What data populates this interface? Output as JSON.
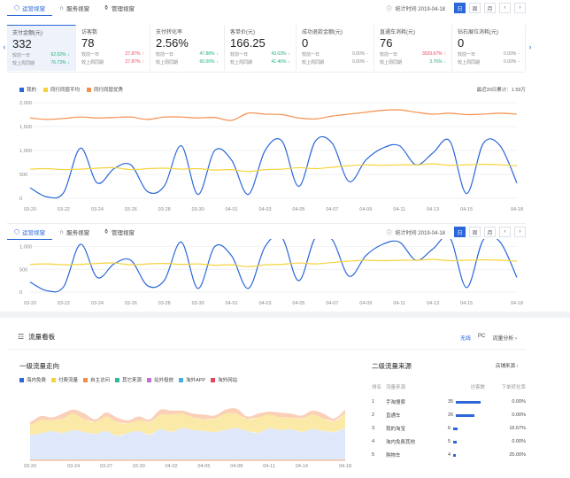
{
  "tabs": [
    {
      "label": "运营视窗",
      "icon": "shield-icon",
      "glyph": "⬡"
    },
    {
      "label": "服务视窗",
      "icon": "headset-icon",
      "glyph": "∩"
    },
    {
      "label": "管理视窗",
      "icon": "flask-icon",
      "glyph": "⚱"
    }
  ],
  "stat_time": {
    "icon": "info-icon",
    "glyph": "ⓘ",
    "label": "统计时间 2019-04-18"
  },
  "range_buttons": [
    "日",
    "周",
    "月"
  ],
  "prev_glyph": "‹",
  "next_glyph": "›",
  "kpis": [
    {
      "title": "支付金额(元)",
      "value": "332",
      "rows": [
        {
          "label": "较前一日",
          "value": "62.02%",
          "arrow": "↓",
          "dir": "dn"
        },
        {
          "label": "较上周同期",
          "value": "76.73%",
          "arrow": "↓",
          "dir": "dn"
        }
      ]
    },
    {
      "title": "访客数",
      "value": "78",
      "rows": [
        {
          "label": "较前一日",
          "value": "27.87%",
          "arrow": "↑",
          "dir": "up"
        },
        {
          "label": "较上周同期",
          "value": "27.87%",
          "arrow": "↑",
          "dir": "up"
        }
      ]
    },
    {
      "title": "支付转化率",
      "value": "2.56%",
      "rows": [
        {
          "label": "较前一日",
          "value": "47.88%",
          "arrow": "↓",
          "dir": "dn"
        },
        {
          "label": "较上周同期",
          "value": "60.00%",
          "arrow": "↓",
          "dir": "dn"
        }
      ]
    },
    {
      "title": "客单价(元)",
      "value": "166.25",
      "rows": [
        {
          "label": "较前一日",
          "value": "43.03%",
          "arrow": "↓",
          "dir": "dn"
        },
        {
          "label": "较上周同期",
          "value": "41.46%",
          "arrow": "↓",
          "dir": "dn"
        }
      ]
    },
    {
      "title": "成功退款金额(元)",
      "value": "0",
      "rows": [
        {
          "label": "较前一日",
          "value": "0.00%",
          "arrow": "-",
          "dir": ""
        },
        {
          "label": "较上周同期",
          "value": "0.00%",
          "arrow": "-",
          "dir": ""
        }
      ]
    },
    {
      "title": "直通车消耗(元)",
      "value": "76",
      "rows": [
        {
          "label": "较前一日",
          "value": "3029.67%",
          "arrow": "↑",
          "dir": "up"
        },
        {
          "label": "较上周同期",
          "value": "3.76%",
          "arrow": "↓",
          "dir": "dn"
        }
      ]
    },
    {
      "title": "钻石展位消耗(元)",
      "value": "0",
      "rows": [
        {
          "label": "较前一日",
          "value": "0.00%",
          "arrow": "-",
          "dir": ""
        },
        {
          "label": "较上周同期",
          "value": "0.00%",
          "arrow": "-",
          "dir": ""
        }
      ]
    }
  ],
  "legend1": [
    {
      "label": "我的",
      "color": "#2b67d9"
    },
    {
      "label": "同行同层平均",
      "color": "#f5d33b"
    },
    {
      "label": "同行同层优秀",
      "color": "#f58d4b"
    }
  ],
  "total_label": "最近30日累计：1.59万",
  "traffic": {
    "title": "流量看板",
    "icon": "chart-icon",
    "glyph": "☲",
    "options": [
      "无线",
      "PC"
    ],
    "analysis_link": "流量分析 ›",
    "l1_title": "一级流量走向",
    "l2_title": "二级流量来源",
    "detail_link": "店铺来源 ›",
    "legend": [
      {
        "label": "海内免费",
        "color": "#2b67d9"
      },
      {
        "label": "付费流量",
        "color": "#f5d33b"
      },
      {
        "label": "自主访问",
        "color": "#f58d4b"
      },
      {
        "label": "其它来源",
        "color": "#2dbb9c"
      },
      {
        "label": "站外投放",
        "color": "#c36dd9"
      },
      {
        "label": "淘外APP",
        "color": "#4aaee8"
      },
      {
        "label": "淘外网站",
        "color": "#e8435c"
      }
    ],
    "table_headers": [
      "排名",
      "流量来源",
      "访客数",
      "下单转化率"
    ],
    "rows": [
      {
        "rank": "1",
        "source": "手淘搜索",
        "visitors": "35",
        "rate": "0.00%"
      },
      {
        "rank": "2",
        "source": "直通车",
        "visitors": "26",
        "rate": "0.00%"
      },
      {
        "rank": "3",
        "source": "我的淘宝",
        "visitors": "6",
        "rate": "16.67%"
      },
      {
        "rank": "4",
        "source": "淘内免费其他",
        "visitors": "5",
        "rate": "0.00%"
      },
      {
        "rank": "5",
        "source": "购物车",
        "visitors": "4",
        "rate": "25.00%"
      }
    ]
  },
  "chart_data": [
    {
      "type": "line",
      "x": [
        "03-20",
        "03-21",
        "03-22",
        "03-23",
        "03-24",
        "03-25",
        "03-26",
        "03-27",
        "03-28",
        "03-29",
        "03-30",
        "03-31",
        "04-01",
        "04-02",
        "04-03",
        "04-04",
        "04-05",
        "04-06",
        "04-07",
        "04-08",
        "04-09",
        "04-10",
        "04-11",
        "04-12",
        "04-13",
        "04-14",
        "04-15",
        "04-16",
        "04-17",
        "04-18"
      ],
      "tick_labels": [
        "03-20",
        "03-22",
        "03-24",
        "03-26",
        "03-28",
        "03-30",
        "04-01",
        "04-03",
        "04-05",
        "04-07",
        "04-09",
        "04-11",
        "04-13",
        "04-15",
        "04-18"
      ],
      "y_ticks": [
        "2,000",
        "1,500",
        "1,000",
        "500",
        "0"
      ],
      "ylim": [
        0,
        2000
      ],
      "series": [
        {
          "name": "我的",
          "color": "#2b67d9",
          "values": [
            220,
            30,
            120,
            1050,
            320,
            620,
            700,
            140,
            260,
            1100,
            80,
            1000,
            800,
            80,
            1000,
            1200,
            250,
            1200,
            1150,
            350,
            800,
            1050,
            1100,
            700,
            950,
            1200,
            100,
            1150,
            1100,
            320
          ]
        },
        {
          "name": "同行同层平均",
          "color": "#f5d33b",
          "values": [
            610,
            620,
            600,
            610,
            630,
            640,
            600,
            620,
            630,
            610,
            620,
            590,
            600,
            560,
            600,
            610,
            640,
            620,
            650,
            680,
            700,
            690,
            700,
            700,
            720,
            690,
            700,
            710,
            700,
            680
          ]
        },
        {
          "name": "同行同层优秀",
          "color": "#f58d4b",
          "values": [
            1680,
            1650,
            1670,
            1700,
            1680,
            1690,
            1700,
            1650,
            1700,
            1700,
            1680,
            1690,
            1630,
            1780,
            1760,
            1750,
            1680,
            1660,
            1720,
            1760,
            1800,
            1840,
            1850,
            1800,
            1760,
            1780,
            1750,
            1760,
            1780,
            1760
          ]
        }
      ]
    },
    {
      "type": "line",
      "x": [
        "03-20",
        "03-21",
        "03-22",
        "03-23",
        "03-24",
        "03-25",
        "03-26",
        "03-27",
        "03-28",
        "03-29",
        "03-30",
        "03-31",
        "04-01",
        "04-02",
        "04-03",
        "04-04",
        "04-05",
        "04-06",
        "04-07",
        "04-08",
        "04-09",
        "04-10",
        "04-11",
        "04-12",
        "04-13",
        "04-14",
        "04-15",
        "04-16",
        "04-17",
        "04-18"
      ],
      "tick_labels": [
        "03-20",
        "03-22",
        "03-24",
        "03-26",
        "03-28",
        "03-30",
        "04-01",
        "04-03",
        "04-05",
        "04-07",
        "04-09",
        "04-11",
        "04-13",
        "04-15",
        "04-18"
      ],
      "y_ticks": [
        "1,000",
        "500",
        "0"
      ],
      "ylim": [
        0,
        1050
      ],
      "series": [
        {
          "name": "我的",
          "color": "#2b67d9",
          "values": [
            220,
            30,
            120,
            1050,
            320,
            620,
            700,
            140,
            260,
            1100,
            80,
            1000,
            800,
            80,
            1000,
            1200,
            250,
            1200,
            1150,
            350,
            800,
            1050,
            1100,
            700,
            950,
            1200,
            100,
            1150,
            1100,
            320
          ]
        },
        {
          "name": "同行同层平均",
          "color": "#f5d33b",
          "values": [
            610,
            620,
            600,
            610,
            630,
            640,
            600,
            620,
            630,
            610,
            620,
            590,
            600,
            560,
            600,
            610,
            640,
            620,
            650,
            680,
            700,
            690,
            700,
            700,
            720,
            690,
            700,
            710,
            700,
            680
          ]
        }
      ]
    },
    {
      "type": "area",
      "x": [
        "03-20",
        "03-21",
        "03-22",
        "03-23",
        "03-24",
        "03-25",
        "03-26",
        "03-27",
        "03-28",
        "03-29",
        "03-30",
        "03-31",
        "04-01",
        "04-02",
        "04-03",
        "04-04",
        "04-05",
        "04-06",
        "04-07",
        "04-08",
        "04-09",
        "04-10",
        "04-11",
        "04-12",
        "04-13",
        "04-14",
        "04-15",
        "04-16",
        "04-17",
        "04-18"
      ],
      "tick_labels": [
        "03-20",
        "03-24",
        "03-27",
        "03-30",
        "04-02",
        "04-05",
        "04-08",
        "04-11",
        "04-14",
        "04-18"
      ],
      "series": [
        {
          "name": "海内免费",
          "color": "#dfe8fb",
          "values": [
            52,
            55,
            60,
            56,
            62,
            58,
            54,
            60,
            50,
            56,
            60,
            52,
            64,
            58,
            66,
            62,
            60,
            58,
            62,
            66,
            60,
            56,
            66,
            62,
            64,
            58,
            64,
            60,
            58,
            66
          ]
        },
        {
          "name": "付费流量",
          "color": "#fbe9a8",
          "values": [
            20,
            28,
            22,
            30,
            34,
            26,
            24,
            30,
            28,
            20,
            22,
            26,
            30,
            36,
            30,
            26,
            24,
            28,
            34,
            30,
            24,
            32,
            28,
            26,
            24,
            28,
            30,
            26,
            22,
            30
          ]
        },
        {
          "name": "自主访问",
          "color": "#fad0b8",
          "values": [
            6,
            8,
            6,
            10,
            8,
            12,
            6,
            8,
            10,
            6,
            8,
            6,
            10,
            8,
            6,
            8,
            10,
            6,
            8,
            10,
            6,
            8,
            6,
            10,
            8,
            6,
            8,
            10,
            6,
            8
          ]
        }
      ]
    }
  ]
}
